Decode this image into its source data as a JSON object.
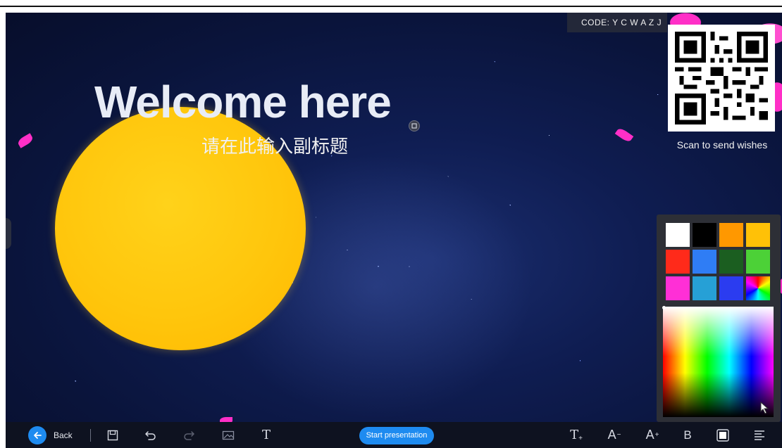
{
  "slide": {
    "title": "Welcome here",
    "subtitle": "请在此输入副标题"
  },
  "code_box": {
    "label": "CODE: Y C W A Z J"
  },
  "qr": {
    "caption": "Scan to send wishes"
  },
  "color_picker": {
    "swatches": [
      "#ffffff",
      "#000000",
      "#ff9800",
      "#ffc107",
      "#ff2a1a",
      "#2f7df5",
      "#1b5e20",
      "#4cd137",
      "#ff2fd6",
      "#26a0d6",
      "#2b3cf0",
      "rainbow"
    ]
  },
  "toolbar": {
    "back_label": "Back",
    "start_label": "Start presentation",
    "text_tool_label": "T",
    "text_add_label": "T",
    "font_decrease_label": "A",
    "font_increase_label": "A",
    "bold_label": "B"
  },
  "colors": {
    "accent": "#1e8bf0",
    "sun": "#ffc60c",
    "petal": "#ff2fc7",
    "toolbar_bg": "#0e1220"
  }
}
